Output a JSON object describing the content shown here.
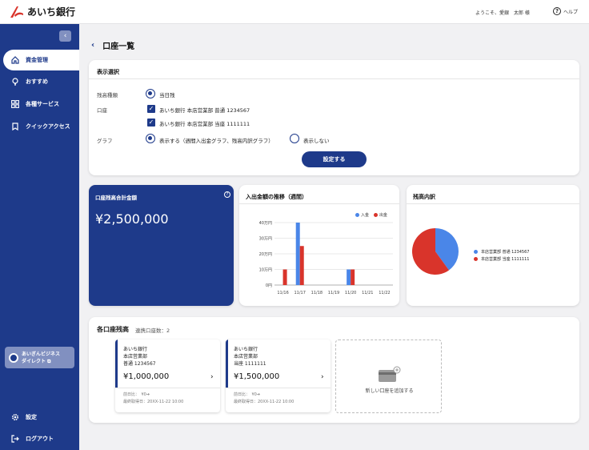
{
  "header": {
    "brand": "あいち銀行",
    "welcome": "ようこそ、愛銀　太郎 様",
    "help": "ヘルプ"
  },
  "sidebar": {
    "collapse": "‹",
    "items": [
      {
        "label": "資金管理",
        "icon": "home-icon",
        "active": true
      },
      {
        "label": "おすすめ",
        "icon": "lightbulb-icon"
      },
      {
        "label": "各種サービス",
        "icon": "grid-icon"
      },
      {
        "label": "クイックアクセス",
        "icon": "bookmark-icon"
      }
    ],
    "biz_line1": "あいぎんビジネス",
    "biz_line2": "ダイレクト",
    "settings": "設定",
    "logout": "ログアウト"
  },
  "page": {
    "title": "口座一覧"
  },
  "selection": {
    "title": "表示選択",
    "balance_type_label": "残高種類",
    "balance_type_value": "当日残",
    "account_label": "口座",
    "accounts": [
      "あいち銀行 本店営業部 普通 1234567",
      "あいち銀行 本店営業部 当座 1111111"
    ],
    "graph_label": "グラフ",
    "graph_show": "表示する（週間入出金グラフ、残高内訳グラフ）",
    "graph_hide": "表示しない",
    "set_button": "設定する"
  },
  "total": {
    "title": "口座残高合計金額",
    "amount": "¥2,500,000"
  },
  "chart_data": [
    {
      "type": "bar",
      "title": "入出金額の推移（週間）",
      "categories": [
        "11/16",
        "11/17",
        "11/18",
        "11/19",
        "11/20",
        "11/21",
        "11/22"
      ],
      "series": [
        {
          "name": "入金",
          "values": [
            0,
            40,
            0,
            0,
            10,
            0,
            0
          ]
        },
        {
          "name": "出金",
          "values": [
            10,
            25,
            0,
            0,
            10,
            0,
            0
          ]
        }
      ],
      "yticks": [
        "0円",
        "10万円",
        "20万円",
        "30万円",
        "40万円"
      ],
      "ylim": [
        0,
        40
      ],
      "colors": {
        "in": "#4a86e8",
        "out": "#d9342b"
      },
      "grid": true,
      "legend": "top-right"
    },
    {
      "type": "pie",
      "title": "残高内訳",
      "labels": [
        "本店営業部 普通 1234567",
        "本店営業部 当座 1111111"
      ],
      "values": [
        1000000,
        1500000
      ],
      "colors": [
        "#4a86e8",
        "#d9342b"
      ],
      "legend": "right"
    }
  ],
  "accounts_section": {
    "title": "各口座残高",
    "count": "連携口座数：2",
    "cards": [
      {
        "bank": "あいち銀行",
        "branch": "本店営業部",
        "kind": "普通 1234567",
        "amount": "¥1,000,000",
        "prev": "前日比：　¥0➔",
        "updated": "最終取得日：20XX-11-22 10:00"
      },
      {
        "bank": "あいち銀行",
        "branch": "本店営業部",
        "kind": "当座 1111111",
        "amount": "¥1,500,000",
        "prev": "前日比：　¥0➔",
        "updated": "最終取得日：20XX-11-22 10:00"
      }
    ],
    "add_label": "新しい口座を追加する"
  }
}
